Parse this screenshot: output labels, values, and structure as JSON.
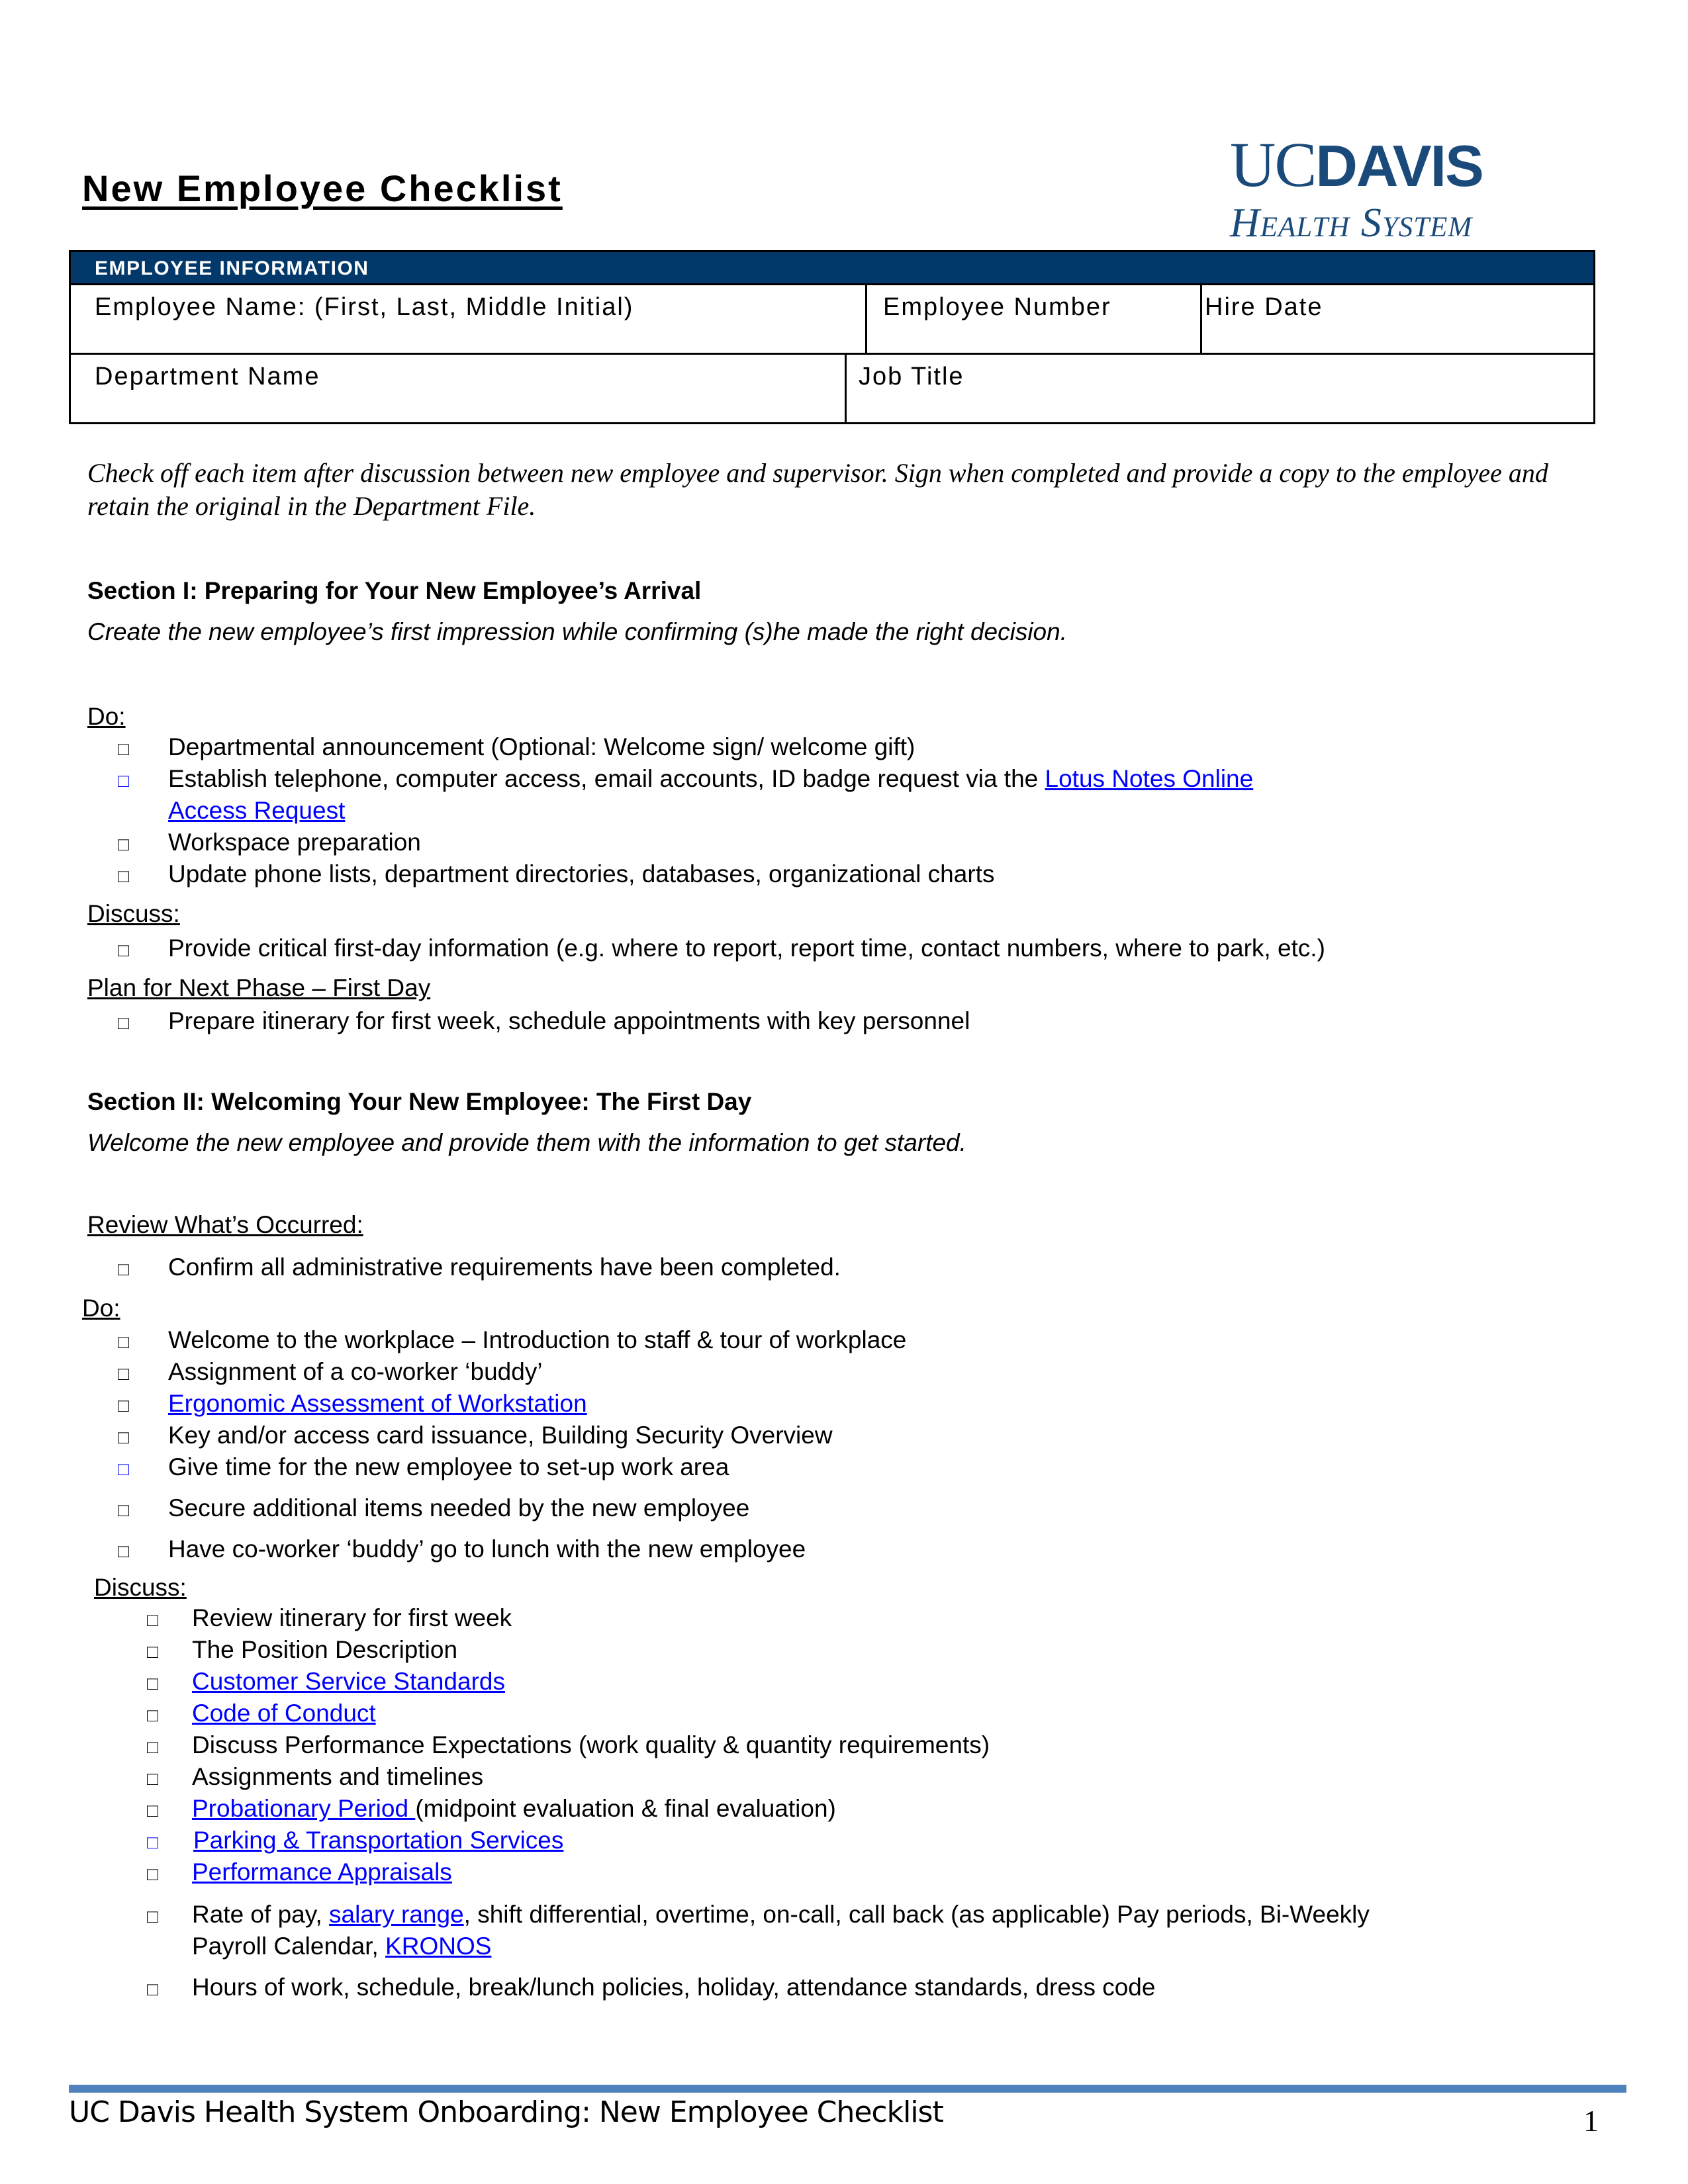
{
  "document": {
    "title": "New Employee Checklist",
    "logo": {
      "line1_light": "UC",
      "line1_bold": "DAVIS",
      "line2": "Health System"
    },
    "colors": {
      "header_bg": "#03386a",
      "link": "#0000ff",
      "footer_bar": "#4f81bd",
      "logo": "#1a4a7a"
    }
  },
  "employee_info": {
    "header": "EMPLOYEE INFORMATION",
    "fields": {
      "employee_name": "Employee Name: (First, Last, Middle Initial)",
      "employee_number": "Employee Number",
      "hire_date": "Hire Date",
      "department_name": "Department Name",
      "job_title": "Job Title"
    }
  },
  "instructions": "Check off each item after discussion between new employee and supervisor. Sign when completed and provide a copy to the employee and retain the original in the Department File.",
  "section1": {
    "heading": "Section I: Preparing for Your New Employee’s Arrival",
    "subheading": "Create the new employee’s first impression while confirming (s)he made the right decision.",
    "do_label": "Do:",
    "do_items": [
      "Departmental announcement (Optional: Welcome sign/ welcome gift)",
      "Establish telephone, computer access, email accounts, ID badge request via the ",
      "Workspace preparation",
      "Update phone lists, department directories, databases, organizational charts"
    ],
    "do_item2_link_line1": "Lotus Notes Online ",
    "do_item2_link_line2": "Access Request",
    "discuss_label": "Discuss:",
    "discuss_items": [
      "Provide critical first-day information (e.g. where to report, report time, contact numbers, where to park, etc.)"
    ],
    "plan_label": "Plan for Next Phase – First Day",
    "plan_items": [
      "Prepare itinerary for first week, schedule appointments with key personnel"
    ]
  },
  "section2": {
    "heading": "Section II: Welcoming Your New Employee: The First Day",
    "subheading": "Welcome the new employee and provide them with the information to get started.",
    "review_label": "Review What’s Occurred:",
    "review_items": [
      "Confirm all administrative requirements have been completed."
    ],
    "do_label": "Do:",
    "do_items": [
      "Welcome to the workplace – Introduction to staff & tour of workplace",
      "Assignment of a co-worker ‘buddy’",
      "Ergonomic Assessment of Workstation",
      "Key and/or access card issuance, Building Security Overview",
      "Give time for the new employee to set-up work area",
      "Secure additional items needed by the new employee",
      "Have co-worker ‘buddy’ go to lunch with the new employee"
    ],
    "discuss_label": "Discuss:",
    "discuss_items": [
      "Review itinerary for first week",
      "The Position Description",
      "Customer Service Standards",
      "Code of Conduct",
      "Discuss Performance Expectations (work quality & quantity requirements)",
      "Assignments and timelines",
      "Probationary Period ",
      "Parking & Transportation Services",
      "Performance Appraisals"
    ],
    "probationary_suffix": "(midpoint evaluation & final evaluation)",
    "pay_item": {
      "prefix": "Rate of pay, ",
      "link1": "salary range",
      "middle": ", shift differential, overtime, on-call, call back (as applicable) Pay periods, Bi-Weekly",
      "line2_prefix": "Payroll Calendar, ",
      "link2": "KRONOS"
    },
    "hours_item": "Hours of work, schedule, break/lunch policies, holiday, attendance standards, dress code"
  },
  "footer": {
    "text": "UC Davis Health System Onboarding: New Employee Checklist",
    "page_number": "1"
  },
  "checkbox_glyph": "□"
}
